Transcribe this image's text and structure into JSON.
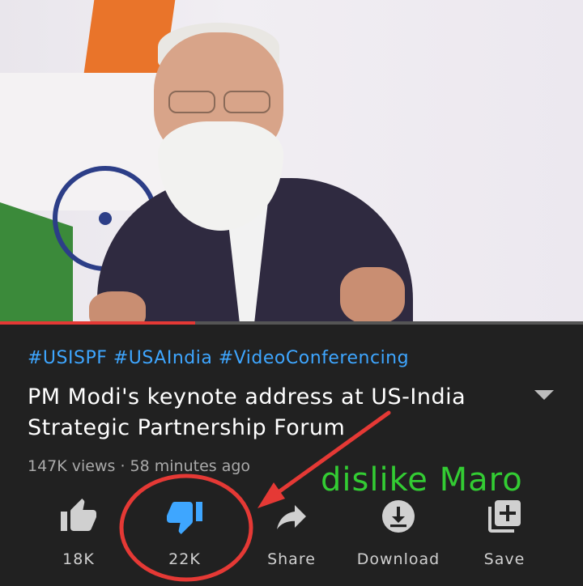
{
  "video": {
    "progress_fraction": 0.335
  },
  "details": {
    "hashtags": "#USISPF #USAIndia #VideoConferencing",
    "title": "PM Modi's keynote address at US-India Strategic Partnership Forum",
    "meta": "147K views · 58 minutes ago"
  },
  "actions": {
    "like": {
      "label": "18K",
      "icon": "thumbs-up-icon"
    },
    "dislike": {
      "label": "22K",
      "icon": "thumbs-down-icon",
      "color": "#3ea6ff"
    },
    "share": {
      "label": "Share",
      "icon": "share-icon"
    },
    "download": {
      "label": "Download",
      "icon": "download-icon"
    },
    "save": {
      "label": "Save",
      "icon": "add-to-playlist-icon"
    }
  },
  "annotation": {
    "text": "dislike Maro",
    "text_color": "#33cc33",
    "marker_color": "#e53935"
  }
}
